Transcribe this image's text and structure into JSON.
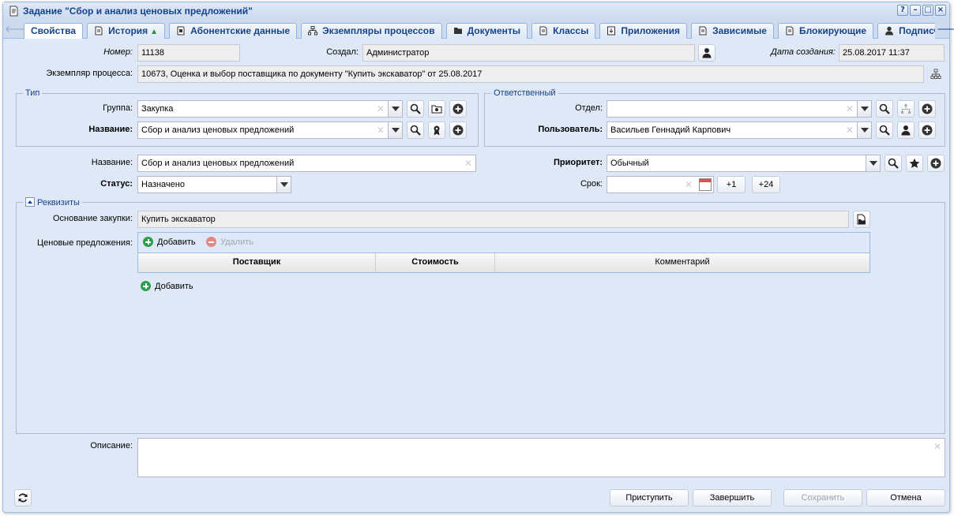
{
  "window": {
    "title": "Задание \"Сбор и анализ ценовых предложений\"",
    "buttons": [
      "?",
      "–",
      "□",
      "×"
    ]
  },
  "tabs": [
    {
      "label": "Свойства",
      "icon": "",
      "active": true
    },
    {
      "label": "История",
      "icon": "document-icon",
      "warning": "▲"
    },
    {
      "label": "Абонентские данные",
      "icon": "contact-card-icon"
    },
    {
      "label": "Экземпляры процессов",
      "icon": "process-tree-icon"
    },
    {
      "label": "Документы",
      "icon": "folder-icon"
    },
    {
      "label": "Классы",
      "icon": "document-icon"
    },
    {
      "label": "Приложения",
      "icon": "attachment-icon"
    },
    {
      "label": "Зависимые",
      "icon": "document-icon"
    },
    {
      "label": "Блокирующие",
      "icon": "document-icon"
    },
    {
      "label": "Подписчи",
      "icon": "person-icon"
    }
  ],
  "header": {
    "number_label": "Номер:",
    "number": "11138",
    "created_by_label": "Создал:",
    "created_by": "Администратор",
    "created_date_label": "Дата создания:",
    "created_date": "25.08.2017 11:37",
    "process_label": "Экземпляр процесса:",
    "process": "10673, Оценка и выбор поставщика по документу \"Купить экскаватор\" от 25.08.2017"
  },
  "type_group": {
    "legend": "Тип",
    "group_label": "Группа:",
    "group": "Закупка",
    "name_label": "Название:",
    "name": "Сбор и анализ ценовых предложений"
  },
  "responsible_group": {
    "legend": "Ответственный",
    "dept_label": "Отдел:",
    "dept": "",
    "user_label": "Пользователь:",
    "user": "Васильев Геннадий Карпович"
  },
  "task": {
    "name_label": "Название:",
    "name": "Сбор и анализ ценовых предложений",
    "status_label": "Статус:",
    "status": "Назначено",
    "priority_label": "Приоритет:",
    "priority": "Обычный",
    "deadline_label": "Срок:",
    "deadline": "",
    "plus1": "+1",
    "plus24": "+24"
  },
  "requisites": {
    "legend": "Реквизиты",
    "basis_label": "Основание закупки:",
    "basis": "Купить экскаватор",
    "offers_label": "Ценовые предложения:",
    "add_label": "Добавить",
    "delete_label": "Удалить",
    "columns": [
      "Поставщик",
      "Стоимость",
      "Комментарий"
    ],
    "add_below_label": "Добавить"
  },
  "description": {
    "label": "Описание:",
    "value": ""
  },
  "footer": {
    "start": "Приступить",
    "finish": "Завершить",
    "save": "Сохранить",
    "cancel": "Отмена"
  }
}
